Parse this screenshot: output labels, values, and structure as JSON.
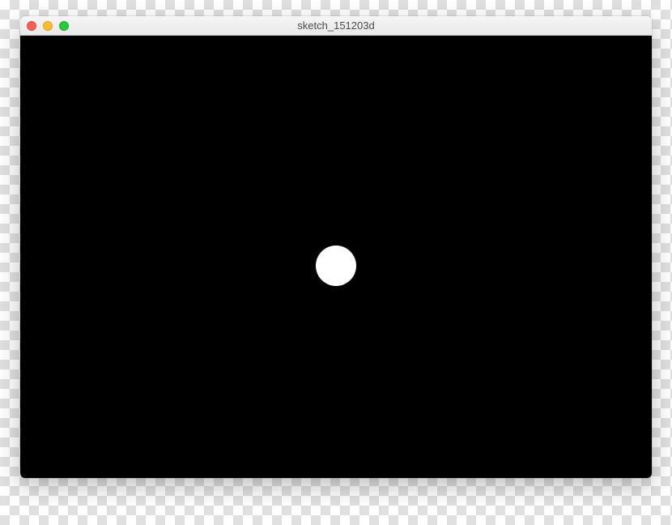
{
  "window": {
    "title": "sketch_151203d"
  },
  "canvas": {
    "background": "#000000",
    "shape": {
      "type": "circle",
      "fill": "#ffffff"
    }
  }
}
